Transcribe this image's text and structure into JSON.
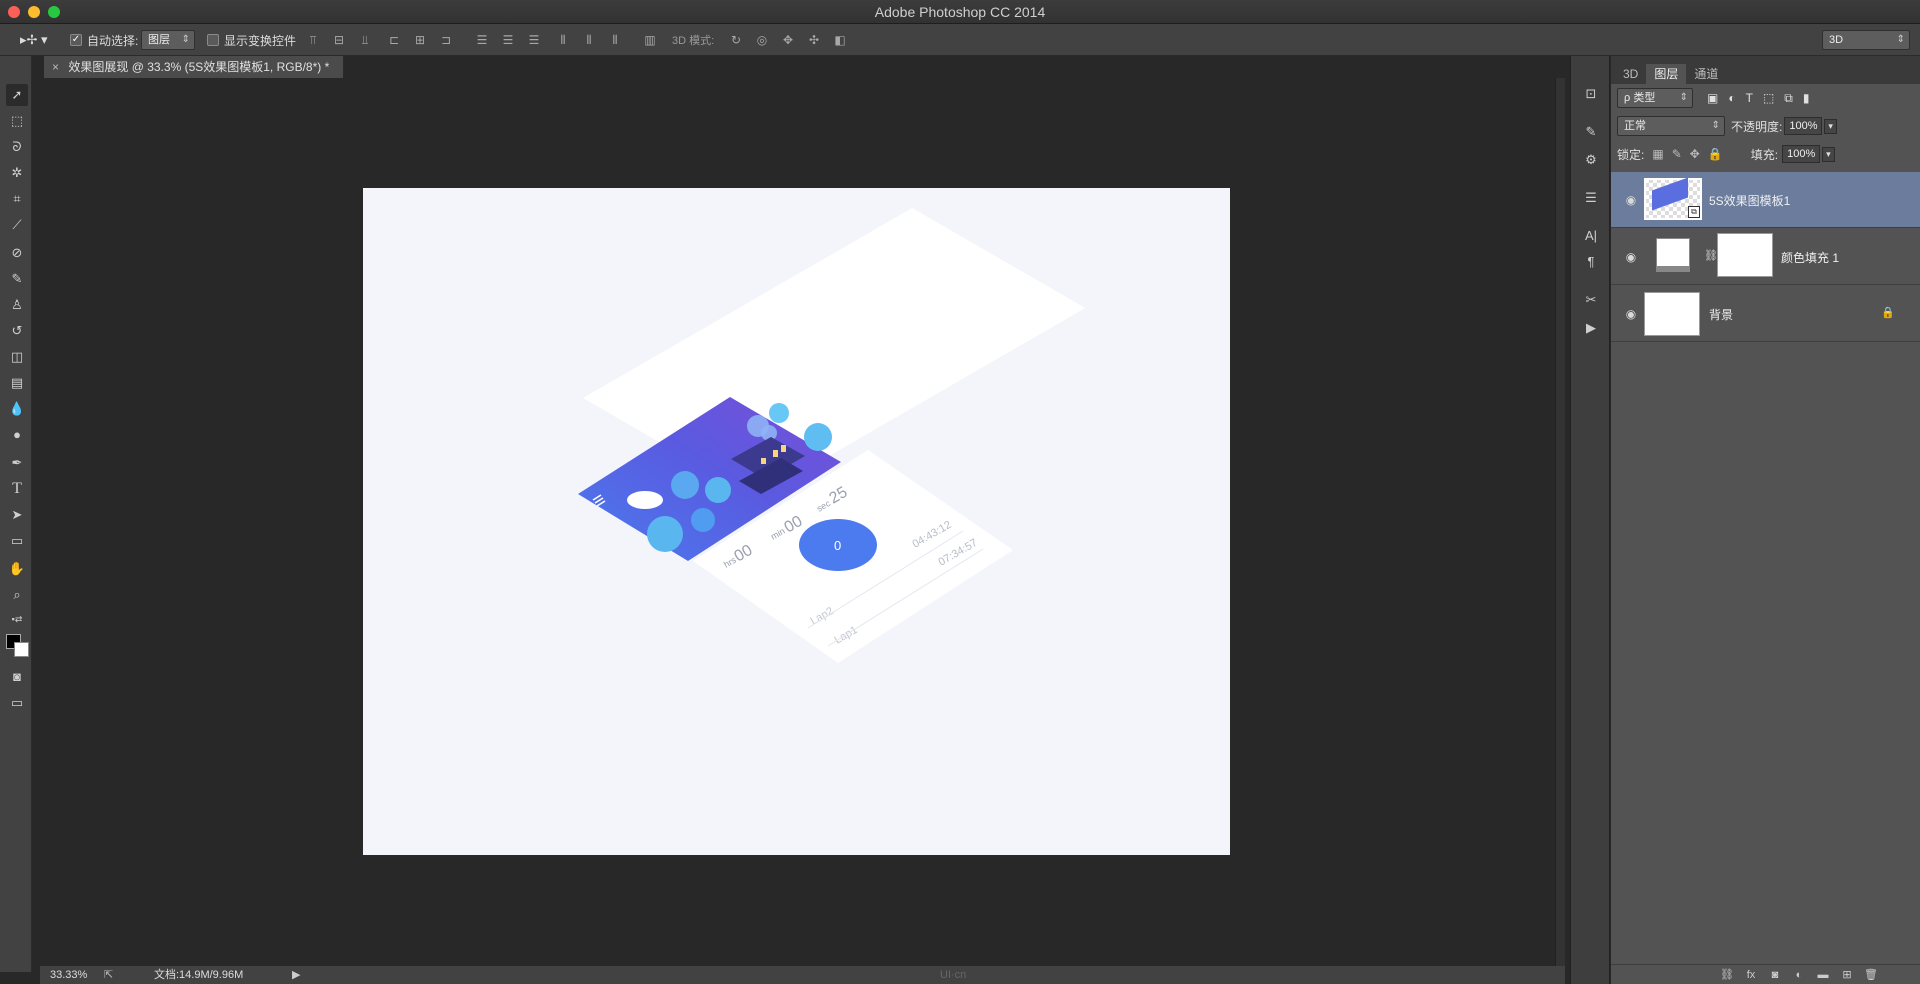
{
  "window": {
    "title": "Adobe Photoshop CC 2014"
  },
  "options": {
    "auto_select_label": "自动选择:",
    "auto_select_value": "图层",
    "show_transform_label": "显示变换控件",
    "mode_3d_label": "3D 模式:",
    "workspace_value": "3D"
  },
  "document": {
    "tab_title": "效果图展现 @ 33.3% (5S效果图模板1, RGB/8*) *",
    "close_glyph": "×"
  },
  "status": {
    "zoom": "33.33%",
    "doc_size": "文档:14.9M/9.96M",
    "watermark": "UI·cn"
  },
  "mockup": {
    "hrs_label": "hrs",
    "hrs_value": "00",
    "min_label": "min",
    "min_value": "00",
    "sec_label": "sec",
    "sec_value": "25",
    "button_label": "0",
    "lap2_label": "Lap2",
    "lap2_value": "04:43:12",
    "lap1_label": "Lap1",
    "lap1_value": "07:34:57"
  },
  "layers_panel": {
    "tabs": [
      "3D",
      "图层",
      "通道"
    ],
    "filter_label": "ρ 类型",
    "blend_mode": "正常",
    "opacity_label": "不透明度:",
    "opacity_value": "100%",
    "lock_label": "锁定:",
    "fill_label": "填充:",
    "fill_value": "100%",
    "layers": [
      {
        "name": "5S效果图模板1"
      },
      {
        "name": "颜色填充 1"
      },
      {
        "name": "背景"
      }
    ]
  },
  "colors": {
    "selected_layer": "#6b7c9d",
    "artboard_bg": "#f4f5fa",
    "accent_blue": "#4b7bef",
    "purple": "#6b4fd8"
  }
}
